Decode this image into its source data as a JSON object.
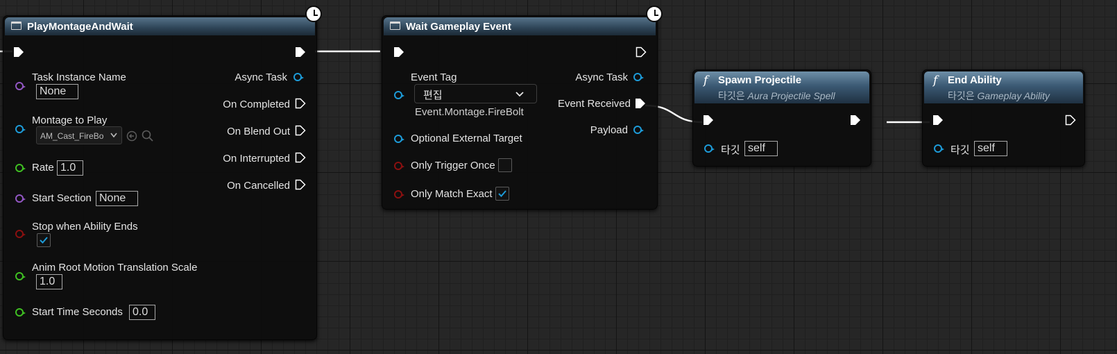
{
  "nodes": {
    "play_montage": {
      "title": "PlayMontageAndWait",
      "inputs": {
        "task_instance_name": {
          "label": "Task Instance Name",
          "value": "None"
        },
        "montage_to_play": {
          "label": "Montage to Play",
          "value": "AM_Cast_FireBo"
        },
        "rate": {
          "label": "Rate",
          "value": "1.0"
        },
        "start_section": {
          "label": "Start Section",
          "value": "None"
        },
        "stop_when_ability_ends": {
          "label": "Stop when Ability Ends",
          "checked": true
        },
        "anim_root_motion": {
          "label": "Anim Root Motion Translation Scale",
          "value": "1.0"
        },
        "start_time_seconds": {
          "label": "Start Time Seconds",
          "value": "0.0"
        }
      },
      "outputs": {
        "async_task": "Async Task",
        "on_completed": "On Completed",
        "on_blend_out": "On Blend Out",
        "on_interrupted": "On Interrupted",
        "on_cancelled": "On Cancelled"
      }
    },
    "wait_gameplay_event": {
      "title": "Wait Gameplay Event",
      "inputs": {
        "event_tag": {
          "label": "Event Tag",
          "dropdown": "편집",
          "value": "Event.Montage.FireBolt"
        },
        "optional_external_target": {
          "label": "Optional External Target"
        },
        "only_trigger_once": {
          "label": "Only Trigger Once",
          "checked": false
        },
        "only_match_exact": {
          "label": "Only Match Exact",
          "checked": true
        }
      },
      "outputs": {
        "async_task": "Async Task",
        "event_received": "Event Received",
        "payload": "Payload"
      }
    },
    "spawn_projectile": {
      "title": "Spawn Projectile",
      "subtitle_prefix": "타깃은",
      "subtitle_class": "Aura Projectile Spell",
      "target_label": "타깃",
      "target_value": "self"
    },
    "end_ability": {
      "title": "End Ability",
      "subtitle_prefix": "타깃은",
      "subtitle_class": "Gameplay Ability",
      "target_label": "타깃",
      "target_value": "self"
    }
  },
  "colors": {
    "exec": "#ffffff",
    "object_pin": "#1d9bd8",
    "name_pin": "#9257c3",
    "float_pin": "#3fbf22",
    "bool_pin": "#8a1010",
    "checkbox_tick": "#1d9bd8"
  },
  "icons": [
    "node-icon",
    "function-icon",
    "latent-clock-icon",
    "exec-pin-icon",
    "checkmark-icon",
    "chevron-down-icon",
    "browse-back-icon",
    "search-icon"
  ]
}
